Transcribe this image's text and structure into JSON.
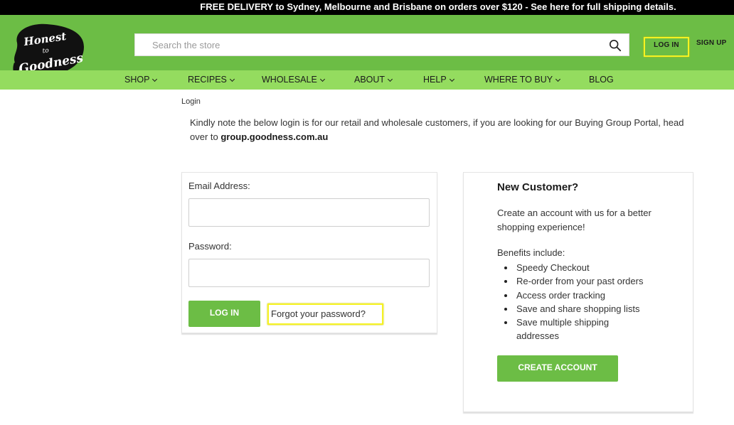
{
  "promo_bar": {
    "text": "FREE DELIVERY to Sydney, Melbourne and Brisbane on orders over $120 - See here for full shipping details."
  },
  "header": {
    "logo": {
      "icon": "honest-to-goodness-logo",
      "text": "Honest to Goodness"
    },
    "search": {
      "placeholder": "Search the store",
      "value": "",
      "icon": "search-icon"
    },
    "login_label": "LOG IN",
    "signup_label": "SIGN UP",
    "highlight_color": "#f5f223"
  },
  "nav": {
    "items": [
      {
        "label": "SHOP",
        "has_dropdown": true
      },
      {
        "label": "RECIPES",
        "has_dropdown": true
      },
      {
        "label": "WHOLESALE",
        "has_dropdown": true
      },
      {
        "label": "ABOUT",
        "has_dropdown": true
      },
      {
        "label": "HELP",
        "has_dropdown": true
      },
      {
        "label": "WHERE TO BUY",
        "has_dropdown": true
      },
      {
        "label": "BLOG",
        "has_dropdown": false
      }
    ]
  },
  "breadcrumb": "Login",
  "notice": {
    "text": "Kindly note the below login is for our retail and wholesale customers, if you are looking for our Buying Group Portal, head over to ",
    "link": "group.goodness.com.au"
  },
  "login_form": {
    "email_label": "Email Address:",
    "email_value": "",
    "password_label": "Password:",
    "password_value": "",
    "submit_label": "LOG IN",
    "forgot_label": "Forgot your password?"
  },
  "new_customer": {
    "title": "New Customer?",
    "description": "Create an account with us for a better shopping experience!",
    "benefits_label": "Benefits include:",
    "benefits": [
      "Speedy Checkout",
      "Re-order from your past orders",
      "Access order tracking",
      "Save and share shopping lists",
      "Save multiple shipping addresses"
    ],
    "button_label": "CREATE ACCOUNT"
  },
  "colors": {
    "brand_green": "#6cbd45",
    "nav_green": "#94dc5f",
    "top_bar": "#000000"
  }
}
